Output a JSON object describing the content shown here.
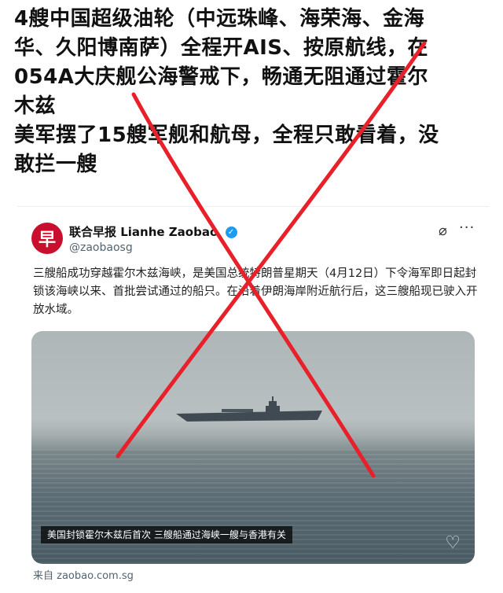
{
  "headline": {
    "lines": [
      "4艘中国超级油轮（中远珠峰、海荣海、金海",
      "华、久阳博南萨）全程开AIS、按原航线，在",
      "054A大庆舰公海警戒下，畅通无阻通过霍尔",
      "木兹",
      "美军摆了15艘军舰和航母，全程只敢看着，没",
      "敢拦一艘"
    ]
  },
  "post": {
    "avatar_char": "早",
    "author": "联合早报 Lianhe Zaobao",
    "handle": "@zaobaosg",
    "text": "三艘船成功穿越霍尔木兹海峡，是美国总统特朗普星期天（4月12日）下令海军即日起封锁该海峡以来、首批尝试通过的船只。在沿着伊朗海岸附近航行后，这三艘船现已驶入开放水域。",
    "image_caption": "美国封锁霍尔木兹后首次 三艘船通过海峡一艘与香港有关",
    "source": "来自 zaobao.com.sg"
  },
  "icons": {
    "verified": "verified-check-icon",
    "grok": "grok-icon",
    "more": "more-icon",
    "like": "heart-icon"
  },
  "colors": {
    "cross": "#e8202a",
    "avatar": "#c8102e",
    "verified": "#1d9bf0"
  }
}
